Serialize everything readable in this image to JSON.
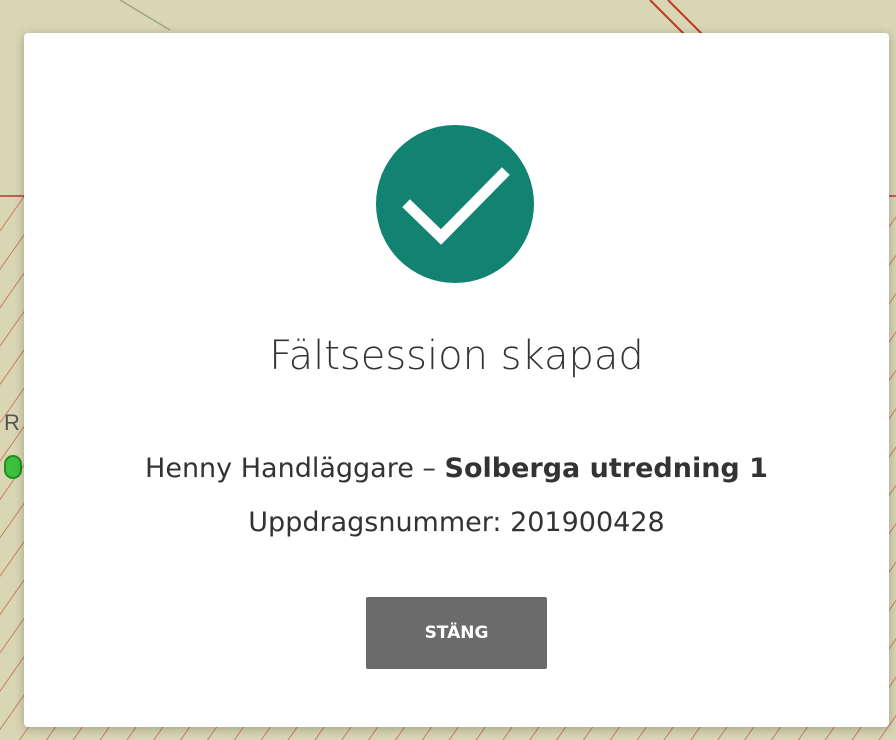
{
  "modal": {
    "title": "Fältsession skapad",
    "user_name": "Henny Handläggare",
    "separator": " – ",
    "session_name": "Solberga utredning 1",
    "assignment_label": "Uppdragsnummer: ",
    "assignment_number": "201900428",
    "close_label": "STÄNG",
    "icon": "checkmark-icon"
  },
  "map": {
    "partial_label": "R"
  },
  "colors": {
    "accent": "#128271",
    "button": "#6b6b6b",
    "map_background": "#dcd3b2",
    "hatch": "#c0392b"
  }
}
